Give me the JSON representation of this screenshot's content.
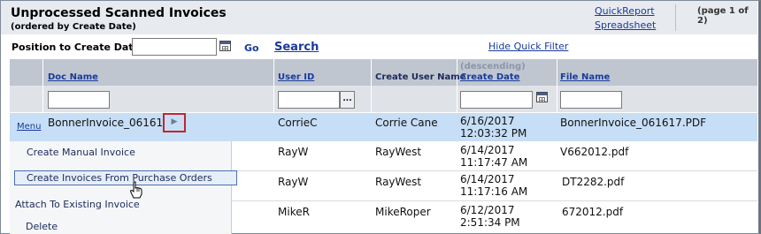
{
  "header": {
    "title": "Unprocessed Scanned Invoices",
    "subtitle": "(ordered by Create Date)",
    "quick_report": "QuickReport",
    "spreadsheet": "Spreadsheet",
    "page_info": "(page 1 of 2)"
  },
  "filter_bar": {
    "position_label": "Position to Create Date",
    "position_value": "",
    "go_label": "Go",
    "search_label": "Search",
    "hide_filter_label": "Hide Quick Filter"
  },
  "columns": {
    "doc_name": "Doc Name",
    "user_id": "User ID",
    "create_user_name": "Create User Name",
    "create_date_sort": "(descending)",
    "create_date": "Create Date",
    "file_name": "File Name"
  },
  "rows": [
    {
      "menu": "Menu",
      "doc_name": "BonnerInvoice_061617",
      "user_id": "CorrieC",
      "user_name": "Corrie Cane",
      "date": "6/16/2017",
      "time": "12:03:32 PM",
      "file_name": "BonnerInvoice_061617.PDF"
    },
    {
      "user_id": "RayW",
      "user_name": "RayWest",
      "date": "6/14/2017",
      "time": "11:17:47 AM",
      "file_name": "V662012.pdf"
    },
    {
      "user_id": "RayW",
      "user_name": "RayWest",
      "date": "6/14/2017",
      "time": "11:17:16 AM",
      "file_name": "DT2282.pdf"
    },
    {
      "user_id": "MikeR",
      "user_name": "MikeRoper",
      "date": "6/12/2017",
      "time": "2:51:34 PM",
      "file_name": "672012.pdf"
    }
  ],
  "context_menu": {
    "items": [
      "Create Manual Invoice",
      "Create Invoices From Purchase Orders",
      "Attach To Existing Invoice",
      "Delete"
    ],
    "hovered_index": 1
  },
  "icons": {
    "calendar": "calendar-icon",
    "ellipsis": "ellipsis-icon",
    "row_arrow": "right-arrow-icon",
    "cursor": "hand-pointer-icon"
  },
  "colors": {
    "link": "#1a3a9c",
    "selected_row": "#c6def6",
    "header_bg": "#bfc6d0",
    "highlight_box": "#c0272d"
  }
}
